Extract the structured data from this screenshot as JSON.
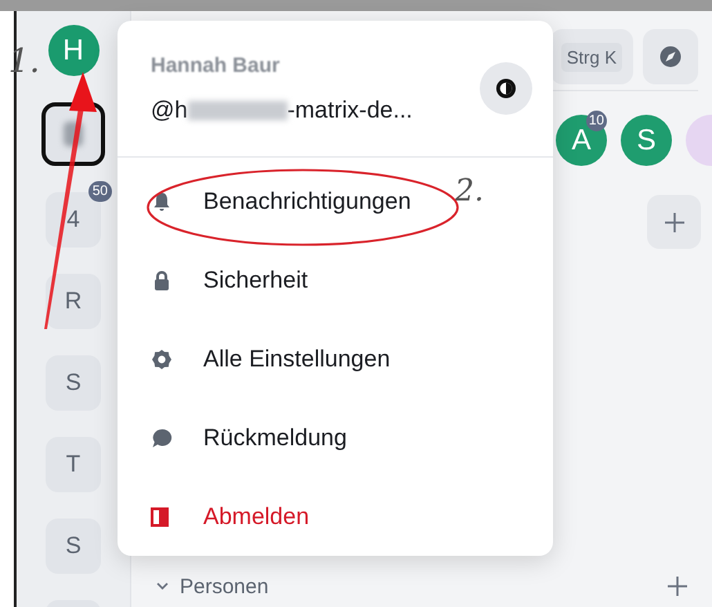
{
  "space_bar": {
    "avatar": "H",
    "items": [
      {
        "kind": "redacted",
        "selected": true
      },
      {
        "kind": "letter",
        "label": "4",
        "badge": "50",
        "selected": false
      },
      {
        "kind": "letter",
        "label": "R",
        "selected": false
      },
      {
        "kind": "letter",
        "label": "S",
        "selected": false
      },
      {
        "kind": "letter",
        "label": "T",
        "selected": false
      },
      {
        "kind": "letter",
        "label": "S",
        "selected": false
      },
      {
        "kind": "blank",
        "selected": false
      }
    ]
  },
  "header": {
    "search_shortcut": "Strg K"
  },
  "room_avatars": [
    {
      "letter": "A",
      "badge": "10",
      "color": "#1f9d6f"
    },
    {
      "letter": "S",
      "color": "#1f9d6f"
    },
    {
      "color": "#e6d6f2"
    }
  ],
  "sections": [
    {
      "title": "Personen",
      "expanded": true
    }
  ],
  "user_menu": {
    "name": "Hannah Baur",
    "handle_start": "@h",
    "handle_end": "-matrix-de...",
    "items": [
      {
        "label": "Benachrichtigungen",
        "danger": false
      },
      {
        "label": "Sicherheit",
        "danger": false
      },
      {
        "label": "Alle Einstellungen",
        "danger": false
      },
      {
        "label": "Rückmeldung",
        "danger": false
      },
      {
        "label": "Abmelden",
        "danger": true
      }
    ]
  },
  "annotations": {
    "step_1": "1.",
    "step_2": "2."
  }
}
